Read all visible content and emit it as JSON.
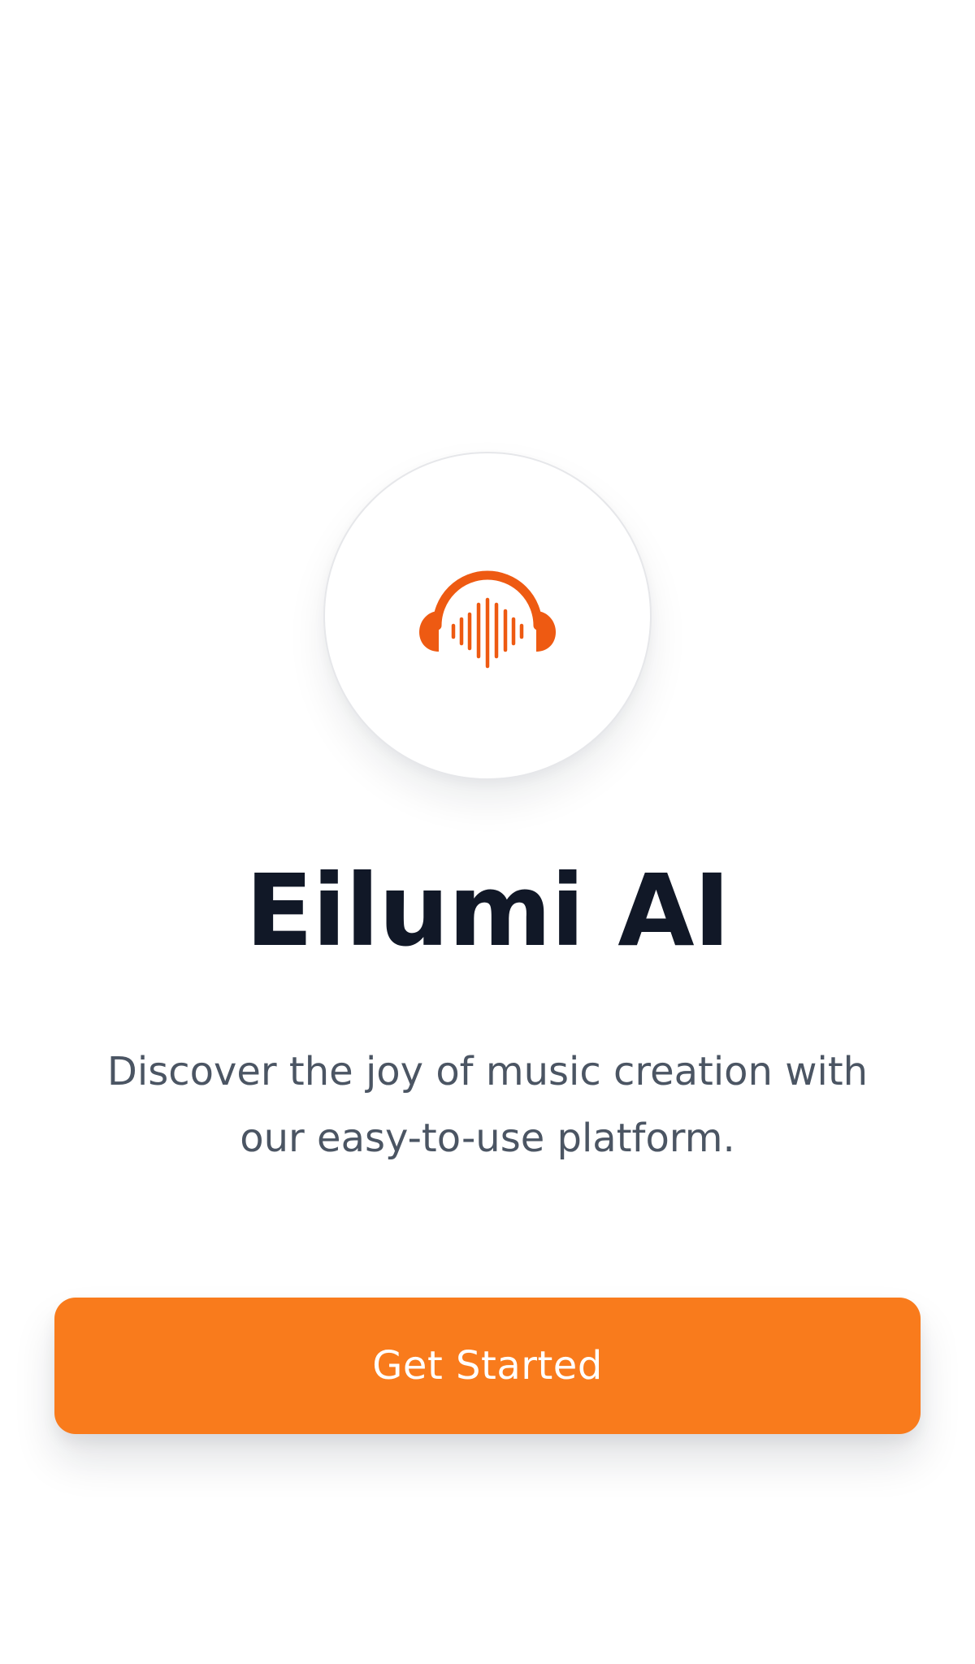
{
  "app": {
    "title": "Eilumi AI",
    "tagline": "Discover the joy of music creation with our easy-to-use platform.",
    "logo_icon": "headphones-waveform-icon"
  },
  "actions": {
    "get_started_label": "Get Started"
  },
  "colors": {
    "accent": "#f97b1c",
    "logo": "#ee5a12",
    "title": "#111827",
    "tagline": "#4b5563",
    "background": "#ffffff"
  }
}
